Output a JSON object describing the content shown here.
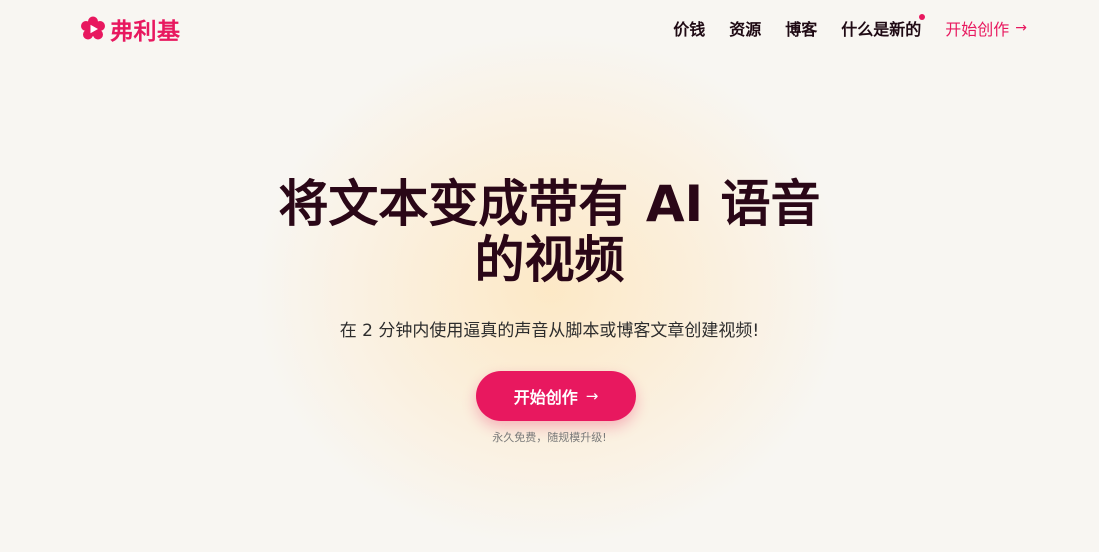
{
  "brand": {
    "name": "弗利基",
    "logo_icon": "play-flower-icon",
    "accent_color": "#e8185f"
  },
  "nav": {
    "items": [
      {
        "label": "价钱"
      },
      {
        "label": "资源"
      },
      {
        "label": "博客"
      },
      {
        "label": "什么是新的",
        "has_new_indicator": true
      }
    ],
    "cta_label": "开始创作",
    "cta_icon": "arrow-right-icon"
  },
  "hero": {
    "title_line1": "将文本变成带有 AI 语音",
    "title_line2": "的视频",
    "subtitle": "在 2 分钟内使用逼真的声音从脚本或博客文章创建视频!",
    "cta_label": "开始创作",
    "cta_icon": "arrow-right-icon",
    "note": "永久免费，随规模升级!"
  },
  "colors": {
    "title": "#2a0717",
    "background": "#f8f6f2",
    "glow": "#fde8c4"
  }
}
